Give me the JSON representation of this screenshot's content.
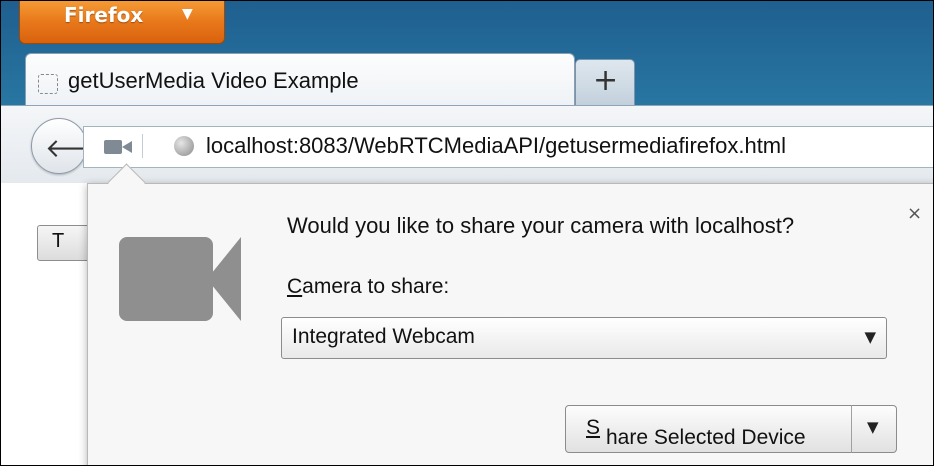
{
  "app_menu": {
    "label": "Firefox",
    "arrow_icon": "chevron-down-icon"
  },
  "tabs": [
    {
      "title": "getUserMedia Video Example",
      "favicon": "blank-page-icon"
    }
  ],
  "new_tab": {
    "label": "+"
  },
  "nav": {
    "back_icon": "back-arrow-icon",
    "identity_icon": "camera-icon",
    "site_icon": "globe-icon",
    "url": "localhost:8083/WebRTCMediaAPI/getusermediafirefox.html"
  },
  "page": {
    "button_partial": "T"
  },
  "permission_prompt": {
    "question": "Would you like to share your camera with localhost?",
    "camera_label_accesskey": "C",
    "camera_label_rest": "amera to share:",
    "selected_device": "Integrated Webcam",
    "share_accesskey": "S",
    "share_rest": "hare Selected Device",
    "close_label": "×",
    "icon": "video-camera-icon"
  },
  "colors": {
    "firefox_orange": "#e8771a",
    "chrome_blue": "#2e86b0",
    "camera_gray": "#8f8f8f"
  }
}
